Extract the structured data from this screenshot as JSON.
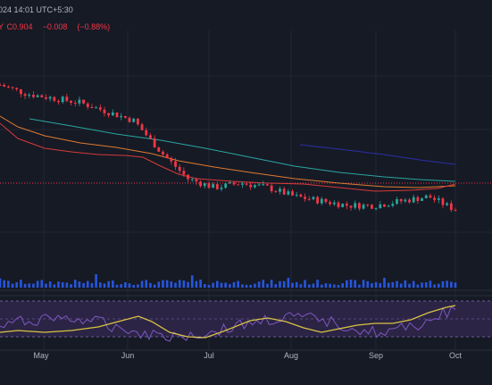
{
  "header": {
    "date_text": "024 14:01 UTC+5:30",
    "prefix": "Y",
    "close_label": "C",
    "close_value": "0.904",
    "change_abs": "−0.008",
    "change_pct": "(−0.88%)"
  },
  "x_axis": {
    "labels": [
      "May",
      "Jun",
      "Jul",
      "Aug",
      "Sep",
      "Oct"
    ]
  },
  "colors": {
    "background": "#161a25",
    "candle_up": "#26a69a",
    "candle_down": "#f23645",
    "ma_red": "#d43a3a",
    "ma_orange": "#e07a2f",
    "ma_teal": "#2aa6a0",
    "ma_blue": "#2b2fa8",
    "volume": "#2962ff",
    "rsi_line": "#7e57c2",
    "rsi_ma": "#d9c244",
    "rsi_band": "#2b2445",
    "price_line": "#f23645"
  },
  "chart_data": {
    "type": "candlestick",
    "x_months": [
      "May",
      "Jun",
      "Jul",
      "Aug",
      "Sep",
      "Oct"
    ],
    "price_trend": [
      1.18,
      1.16,
      1.15,
      1.14,
      1.12,
      1.1,
      1.03,
      0.97,
      0.95,
      0.96,
      0.95,
      0.93,
      0.92,
      0.91,
      0.91,
      0.92,
      0.93,
      0.9
    ],
    "last_close": 0.904,
    "change_abs": -0.008,
    "change_pct": -0.88,
    "indicators": [
      "volume",
      "rsi"
    ]
  }
}
